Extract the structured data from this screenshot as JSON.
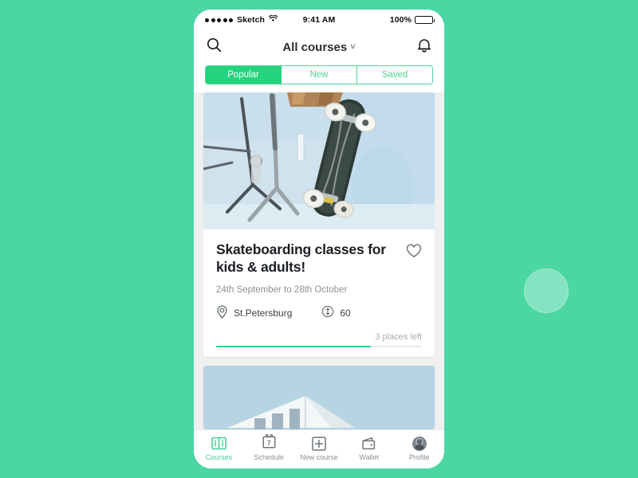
{
  "background_color": "#4bd6a4",
  "accent_color": "#24d47e",
  "status_bar": {
    "signal_dots": 5,
    "carrier": "Sketch",
    "wifi_icon": "wifi-icon",
    "time": "9:41 AM",
    "battery_percent": "100%",
    "battery_icon": "battery-full-icon"
  },
  "nav_bar": {
    "search_icon": "search-icon",
    "title": "All courses",
    "chevron": "˅",
    "bell_icon": "bell-icon"
  },
  "segmented_control": {
    "options": [
      {
        "label": "Popular",
        "active": true
      },
      {
        "label": "New",
        "active": false
      },
      {
        "label": "Saved",
        "active": false
      }
    ]
  },
  "feed": {
    "cards": [
      {
        "photo_alt": "skateboard-photo",
        "title": "Skateboarding classes for kids & adults!",
        "favorite_icon": "heart-outline-icon",
        "dates": "24th September to 28th October",
        "location_icon": "map-pin-icon",
        "location": "St.Petersburg",
        "price_icon": "coin-icon",
        "price": "60",
        "places_left": "3 places left",
        "progress_percent": 75
      },
      {
        "photo_alt": "white-building-photo"
      }
    ]
  },
  "tab_bar": {
    "tabs": [
      {
        "label": "Courses",
        "icon": "book-open-icon",
        "active": true
      },
      {
        "label": "Schedule",
        "icon": "calendar-icon",
        "badge": "7",
        "active": false
      },
      {
        "label": "New course",
        "icon": "plus-square-icon",
        "active": false
      },
      {
        "label": "Wallet",
        "icon": "wallet-icon",
        "active": false
      },
      {
        "label": "Profile",
        "icon": "avatar-icon",
        "active": false
      }
    ]
  },
  "touch_indicator": {
    "name": "cursor-touch-indicator"
  }
}
